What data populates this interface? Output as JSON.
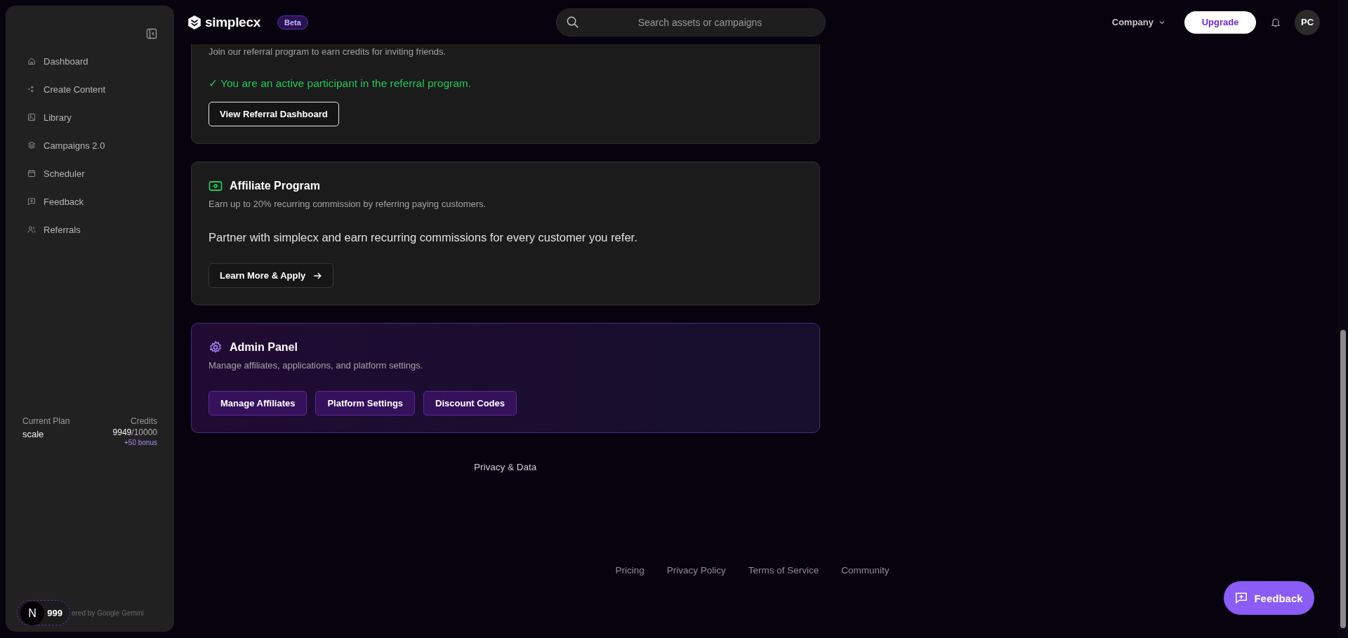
{
  "sidebar": {
    "items": [
      {
        "label": "Dashboard"
      },
      {
        "label": "Create Content"
      },
      {
        "label": "Library"
      },
      {
        "label": "Campaigns 2.0"
      },
      {
        "label": "Scheduler"
      },
      {
        "label": "Feedback"
      },
      {
        "label": "Referrals"
      }
    ],
    "plan": {
      "label": "Current Plan",
      "value": "scale"
    },
    "credits": {
      "label": "Credits",
      "used": "9949",
      "total": "/10000",
      "bonus": "+50 bonus"
    },
    "badge": {
      "letter": "N",
      "count": "999"
    },
    "powered": "ered by Google Gemini"
  },
  "header": {
    "logo": "simplecx",
    "tag": "Beta",
    "search": {
      "placeholder": "Search assets or campaigns"
    },
    "menu": "Company",
    "upgrade": "Upgrade",
    "avatar": "PC"
  },
  "cards": [
    {
      "kind": "referral",
      "description": "Join our referral program to earn credits for inviting friends.",
      "status": "✓ You are an active participant in the referral program.",
      "buttons": [
        {
          "label": "View Referral Dashboard",
          "arrow": false
        }
      ]
    },
    {
      "kind": "affiliate",
      "title": "Affiliate Program",
      "description": "Earn up to 20% recurring commission by referring paying customers.",
      "body": "Partner with simplecx and earn recurring commissions for every customer you refer.",
      "buttons": [
        {
          "label": "Learn More & Apply",
          "arrow": true
        }
      ]
    },
    {
      "kind": "admin",
      "title": "Admin Panel",
      "description": "Manage affiliates, applications, and platform settings.",
      "buttons": [
        {
          "label": "Manage Affiliates",
          "arrow": false
        },
        {
          "label": "Platform Settings",
          "arrow": false
        },
        {
          "label": "Discount Codes",
          "arrow": false
        }
      ]
    }
  ],
  "privacy_link": "Privacy & Data",
  "footer": {
    "links": [
      "Pricing",
      "Privacy Policy",
      "Terms of Service",
      "Community"
    ]
  },
  "feedback_button": "Feedback"
}
